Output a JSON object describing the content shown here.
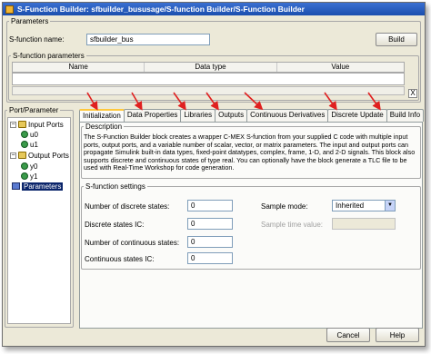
{
  "window": {
    "title": "S-Function Builder: sfbuilder_bususage/S-function Builder/S-Function Builder"
  },
  "parameters": {
    "legend": "Parameters",
    "sfunction_name_label": "S-function name:",
    "sfunction_name_value": "sfbuilder_bus",
    "build_label": "Build",
    "sfunction_parameters_legend": "S-function parameters",
    "columns": [
      "Name",
      "Data type",
      "Value"
    ],
    "close_symbol": "X"
  },
  "port_parameter": {
    "legend": "Port/Parameter",
    "tree": [
      {
        "label": "Input Ports",
        "expander": "−",
        "icon": "port-icon"
      },
      {
        "label": "u0",
        "icon": "pin-icon"
      },
      {
        "label": "u1",
        "icon": "pin-icon"
      },
      {
        "label": "Output Ports",
        "expander": "−",
        "icon": "port-icon"
      },
      {
        "label": "y0",
        "icon": "pin-icon"
      },
      {
        "label": "y1",
        "icon": "pin-icon"
      },
      {
        "label": "Parameters",
        "icon": "params-icon"
      }
    ]
  },
  "tabs": [
    "Initialization",
    "Data Properties",
    "Libraries",
    "Outputs",
    "Continuous Derivatives",
    "Discrete Update",
    "Build Info"
  ],
  "description": {
    "legend": "Description",
    "text": "The S-Function Builder block creates a wrapper C-MEX S-function from your supplied C code with multiple input ports, output ports, and a variable number of scalar, vector, or matrix parameters. The input and output ports can propagate Simulink built-in data types, fixed-point datatypes, complex, frame, 1-D, and 2-D signals. This block also supports discrete and continuous states of type real. You can optionally have the block generate a TLC file to be used with Real-Time Workshop for code generation."
  },
  "settings": {
    "legend": "S-function settings",
    "num_discrete_label": "Number of discrete states:",
    "num_discrete_value": "0",
    "discrete_ic_label": "Discrete states IC:",
    "discrete_ic_value": "0",
    "num_continuous_label": "Number of continuous states:",
    "num_continuous_value": "0",
    "continuous_ic_label": "Continuous states IC:",
    "continuous_ic_value": "0",
    "sample_mode_label": "Sample mode:",
    "sample_mode_value": "Inherited",
    "sample_time_label": "Sample time value:",
    "sample_time_value": ""
  },
  "footer": {
    "cancel_label": "Cancel",
    "help_label": "Help"
  },
  "colors": {
    "arrow": "#e02020",
    "active_tab_accent": "#ffc83c",
    "title_bar": "#1b4fae"
  }
}
